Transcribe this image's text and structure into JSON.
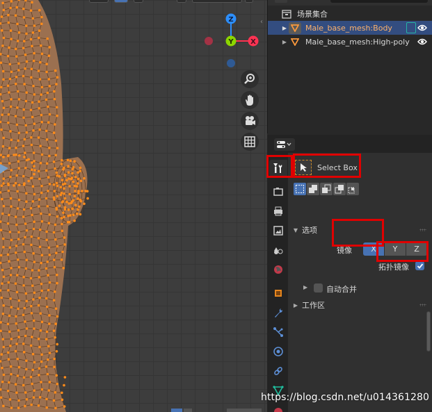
{
  "outliner": {
    "collection_label": "场景集合",
    "items": [
      {
        "label": "Male_base_mesh:Body",
        "selected": true
      },
      {
        "label": "Male_base_mesh:High-poly",
        "selected": false
      }
    ]
  },
  "properties": {
    "active_tool": "Select Box",
    "options_label": "选项",
    "mirror_label": "镜像",
    "mirror_axes": [
      "X",
      "Y",
      "Z"
    ],
    "mirror_active_axis": "X",
    "topology_mirror_label": "拓扑镜像",
    "topology_mirror_checked": true,
    "auto_merge_label": "自动合并",
    "auto_merge_checked": false,
    "workspace_label": "工作区"
  },
  "gizmo": {
    "z_label": "Z",
    "y_label": "Y",
    "x_label": "X"
  },
  "colors": {
    "selection_blue": "#4772b3",
    "annotation_red": "#e00000",
    "mesh_orange": "#ff8c1a"
  },
  "watermark": "https://blog.csdn.net/u014361280"
}
